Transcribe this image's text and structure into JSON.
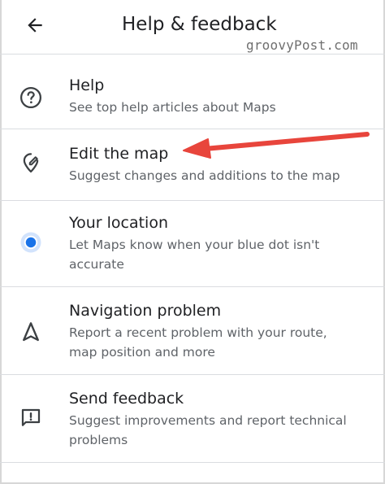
{
  "header": {
    "title": "Help & feedback",
    "back_icon": "arrow-left-icon"
  },
  "watermark": "groovyPost.com",
  "items": [
    {
      "label": "Help",
      "description": "See top help articles about Maps",
      "icon": "help-circle-icon"
    },
    {
      "label": "Edit the map",
      "description": "Suggest changes and additions to the map",
      "icon": "edit-location-icon"
    },
    {
      "label": "Your location",
      "description": "Let Maps know when your blue dot isn't accurate",
      "icon": "blue-dot-icon"
    },
    {
      "label": "Navigation problem",
      "description": "Report a recent problem with your route, map position and more",
      "icon": "navigation-arrow-icon"
    },
    {
      "label": "Send feedback",
      "description": "Suggest improvements and report technical problems",
      "icon": "feedback-icon"
    }
  ],
  "colors": {
    "annotation_arrow": "#e8453c",
    "location_dot": "#1a73e8",
    "location_dot_halo": "#d2e3fc"
  }
}
